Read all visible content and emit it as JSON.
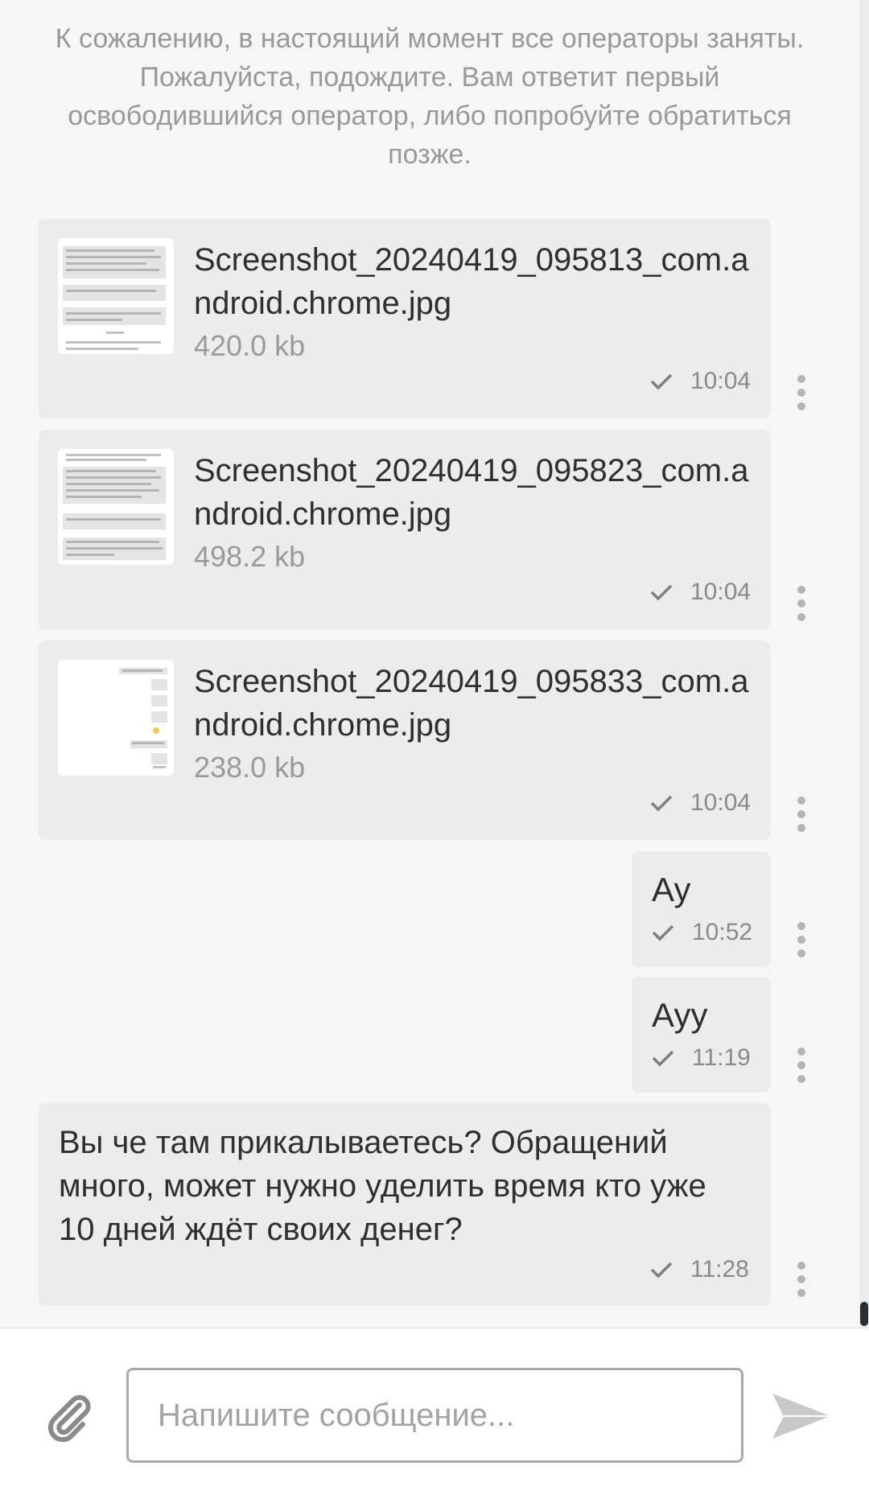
{
  "system_notice": "К сожалению, в настоящий момент все операторы заняты. Пожалуйста, подождите. Вам ответит первый освободившийся оператор, либо попробуйте обратиться позже.",
  "messages": [
    {
      "type": "file",
      "file_name": "Screenshot_20240419_095813_com.android.chrome.jpg",
      "file_size": "420.0 kb",
      "time": "10:04"
    },
    {
      "type": "file",
      "file_name": "Screenshot_20240419_095823_com.android.chrome.jpg",
      "file_size": "498.2 kb",
      "time": "10:04"
    },
    {
      "type": "file",
      "file_name": "Screenshot_20240419_095833_com.android.chrome.jpg",
      "file_size": "238.0 kb",
      "time": "10:04"
    },
    {
      "type": "text",
      "text": "Ау",
      "time": "10:52"
    },
    {
      "type": "text",
      "text": "Ауу",
      "time": "11:19"
    },
    {
      "type": "text",
      "text": "Вы че там прикалываетесь? Обращений много, может нужно уделить время кто уже 10 дней ждёт своих денег?",
      "time": "11:28"
    }
  ],
  "composer": {
    "placeholder": "Напишите сообщение...",
    "attach_icon": "paperclip-icon",
    "send_icon": "send-icon"
  },
  "colors": {
    "background": "#f6f6f6",
    "bubble": "#ececec",
    "muted_text": "#999999",
    "text": "#2f2f2f",
    "send_icon": "#c8c8c8"
  }
}
